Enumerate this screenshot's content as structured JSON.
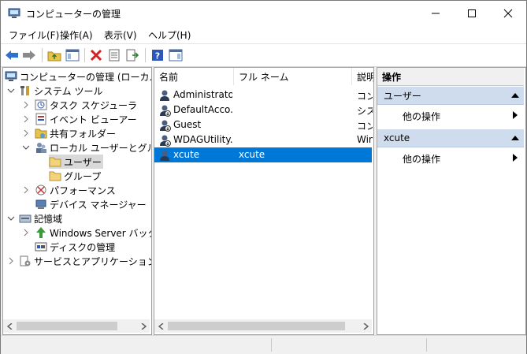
{
  "window": {
    "title": "コンピューターの管理"
  },
  "menu": [
    {
      "label": "ファイル(F)"
    },
    {
      "label": "操作(A)"
    },
    {
      "label": "表示(V)"
    },
    {
      "label": "ヘルプ(H)"
    }
  ],
  "tree": {
    "root": "コンピューターの管理 (ローカル)",
    "system_tools": "システム ツール",
    "task_scheduler": "タスク スケジューラ",
    "event_viewer": "イベント ビューアー",
    "shared_folders": "共有フォルダー",
    "local_users": "ローカル ユーザーとグループ",
    "users": "ユーザー",
    "groups": "グループ",
    "performance": "パフォーマンス",
    "device_manager": "デバイス マネージャー",
    "storage": "記憶域",
    "backup": "Windows Server バックア",
    "disk_mgmt": "ディスクの管理",
    "services": "サービスとアプリケーション"
  },
  "list": {
    "columns": [
      "名前",
      "フル ネーム",
      "説明"
    ],
    "rows": [
      {
        "name": "Administrator",
        "fullname": "",
        "desc": "コン"
      },
      {
        "name": "DefaultAcco...",
        "fullname": "",
        "desc": "シス"
      },
      {
        "name": "Guest",
        "fullname": "",
        "desc": "コン"
      },
      {
        "name": "WDAGUtility...",
        "fullname": "",
        "desc": "Win"
      },
      {
        "name": "xcute",
        "fullname": "xcute",
        "desc": ""
      }
    ],
    "selected_index": 4
  },
  "actions": {
    "title": "操作",
    "sections": [
      {
        "header": "ユーザー",
        "item": "他の操作"
      },
      {
        "header": "xcute",
        "item": "他の操作"
      }
    ]
  },
  "colors": {
    "selection": "#0078d7",
    "action_header": "#cfdcee"
  }
}
